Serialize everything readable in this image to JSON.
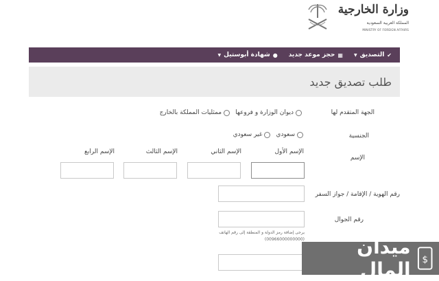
{
  "header": {
    "logo_ar": "وزارة الخارجية",
    "logo_sub": "المملكة العربية السعودية",
    "logo_en": "MINISTRY OF FOREIGN AFFAIRS"
  },
  "nav": {
    "items": [
      {
        "label": "التصديق",
        "icon": "check-circle-icon",
        "dropdown": true
      },
      {
        "label": "حجز موعد جديد",
        "icon": "calendar-icon",
        "dropdown": false
      },
      {
        "label": "شهادة أبوستيل",
        "icon": "circle-icon",
        "dropdown": true
      }
    ],
    "bg_color": "#5a3f5a"
  },
  "page_title": "طلب تصديق جديد",
  "form": {
    "entity_label": "الجهة المتقدم لها",
    "entity_options": [
      "ديوان الوزارة و فروعها",
      "ممثليات المملكة بالخارج"
    ],
    "nationality_label": "الجنسية",
    "nationality_options": [
      "سعودي",
      "غير سعودي"
    ],
    "name_label": "الإسم",
    "name_parts": [
      "الإسم الأول",
      "الإسم الثاني",
      "الإسم الثالث",
      "الإسم الرابع"
    ],
    "id_label": "رقم الهوية / الإقامة / جواز السفر",
    "mobile_label": "رقم الجوال",
    "mobile_hint_1": "يرجى إضافة رمز الدولة و المنطقة إلى رقم الهاتف",
    "mobile_hint_2": "(00966000000000)"
  },
  "watermark": {
    "text": "ميدان المال"
  }
}
